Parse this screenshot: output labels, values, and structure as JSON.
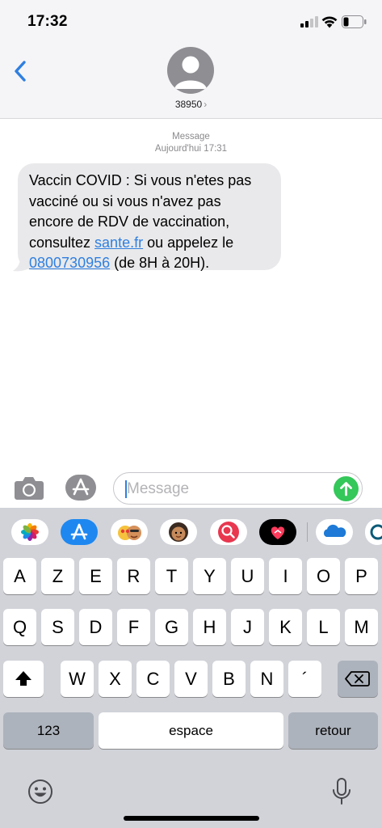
{
  "status_bar": {
    "time": "17:32"
  },
  "header": {
    "contact_name": "38950",
    "chevron": "›"
  },
  "thread": {
    "service_label": "Message",
    "timestamp": "Aujourd'hui 17:31",
    "message": {
      "line1": "Vaccin COVID : Si vous n'etes pas",
      "line2": "vacciné ou si vous n'avez pas",
      "line3": "encore de RDV de vaccination,",
      "line4_before": "consultez ",
      "link_site": "sante.fr",
      "line4_after": " ou appelez le",
      "link_phone": "0800730956",
      "line5_after": " (de 8H à 20H)."
    }
  },
  "compose": {
    "placeholder": "Message"
  },
  "app_drawer": {
    "apps": [
      "photos-icon",
      "app-store-icon",
      "memoji-stickers-icon",
      "memoji-icon",
      "search-images-icon",
      "digital-touch-icon",
      "onedrive-icon",
      "more-apps-icon"
    ]
  },
  "keyboard": {
    "row1": [
      "A",
      "Z",
      "E",
      "R",
      "T",
      "Y",
      "U",
      "I",
      "O",
      "P"
    ],
    "row2": [
      "Q",
      "S",
      "D",
      "F",
      "G",
      "H",
      "J",
      "K",
      "L",
      "M"
    ],
    "row3": [
      "W",
      "X",
      "C",
      "V",
      "B",
      "N",
      "´"
    ],
    "numbers_label": "123",
    "space_label": "espace",
    "return_label": "retour"
  },
  "colors": {
    "accent": "#2f7fe0",
    "send": "#34c759",
    "bubble": "#e9e9eb",
    "keyboard_bg": "#d1d3d9"
  }
}
